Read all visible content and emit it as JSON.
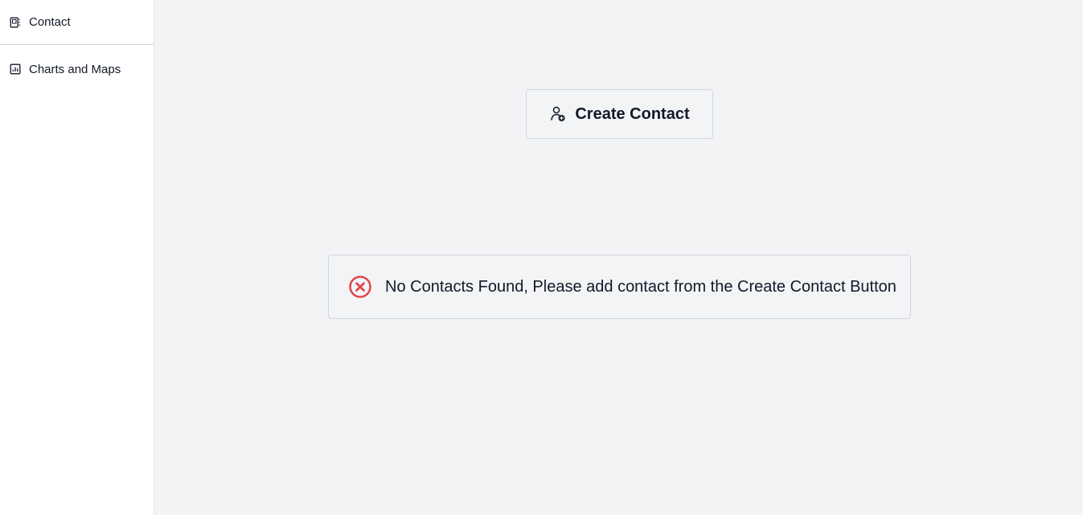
{
  "sidebar": {
    "items": [
      {
        "label": "Contact",
        "icon": "contact-book-icon"
      },
      {
        "label": "Charts and Maps",
        "icon": "bar-chart-icon"
      }
    ]
  },
  "main": {
    "create_button": {
      "label": "Create Contact",
      "icon": "user-add-icon"
    },
    "empty_state": {
      "message": "No Contacts Found, Please add contact from the Create Contact Button",
      "icon": "error-circle-x-icon",
      "icon_color": "#e0464a"
    }
  },
  "colors": {
    "background": "#f2f3f5",
    "sidebar": "#ffffff",
    "border": "#d1d5db",
    "text": "#111827"
  }
}
